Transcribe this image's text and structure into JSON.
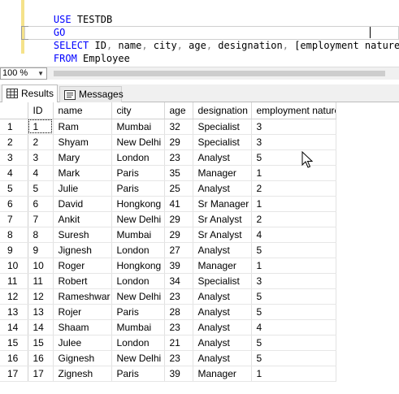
{
  "editor": {
    "line1": {
      "kw": "USE",
      "rest": " TESTDB"
    },
    "line2": {
      "kw": "GO"
    },
    "line3": {
      "kw": "SELECT",
      "p1": " ID",
      "c1": ",",
      "p2": " name",
      "c2": ",",
      "p3": " city",
      "c3": ",",
      "p4": " age",
      "c4": ",",
      "p5": " designation",
      "c5": ",",
      "p6": " [employment nature]"
    },
    "line4": {
      "kw": "FROM",
      "rest": " Employee"
    }
  },
  "zoom": {
    "value": "100 %",
    "arrow": "▼"
  },
  "tabs": [
    {
      "label": "Results",
      "icon": "grid-results-icon"
    },
    {
      "label": "Messages",
      "icon": "messages-icon"
    }
  ],
  "grid": {
    "columns": [
      "ID",
      "name",
      "city",
      "age",
      "designation",
      "employment nature"
    ],
    "rows": [
      {
        "n": "1",
        "id": "1",
        "name": "Ram",
        "city": "Mumbai",
        "age": "32",
        "designation": "Specialist",
        "nature": "3"
      },
      {
        "n": "2",
        "id": "2",
        "name": "Shyam",
        "city": "New Delhi",
        "age": "29",
        "designation": "Specialist",
        "nature": "3"
      },
      {
        "n": "3",
        "id": "3",
        "name": "Mary",
        "city": "London",
        "age": "23",
        "designation": "Analyst",
        "nature": "5"
      },
      {
        "n": "4",
        "id": "4",
        "name": "Mark",
        "city": "Paris",
        "age": "35",
        "designation": "Manager",
        "nature": "1"
      },
      {
        "n": "5",
        "id": "5",
        "name": "Julie",
        "city": "Paris",
        "age": "25",
        "designation": "Analyst",
        "nature": "2"
      },
      {
        "n": "6",
        "id": "6",
        "name": "David",
        "city": "Hongkong",
        "age": "41",
        "designation": "Sr Manager",
        "nature": "1"
      },
      {
        "n": "7",
        "id": "7",
        "name": "Ankit",
        "city": "New Delhi",
        "age": "29",
        "designation": "Sr Analyst",
        "nature": "2"
      },
      {
        "n": "8",
        "id": "8",
        "name": "Suresh",
        "city": "Mumbai",
        "age": "29",
        "designation": "Sr Analyst",
        "nature": "4"
      },
      {
        "n": "9",
        "id": "9",
        "name": "Jignesh",
        "city": "London",
        "age": "27",
        "designation": "Analyst",
        "nature": "5"
      },
      {
        "n": "10",
        "id": "10",
        "name": "Roger",
        "city": "Hongkong",
        "age": "39",
        "designation": "Manager",
        "nature": "1"
      },
      {
        "n": "11",
        "id": "11",
        "name": "Robert",
        "city": "London",
        "age": "34",
        "designation": "Specialist",
        "nature": "3"
      },
      {
        "n": "12",
        "id": "12",
        "name": "Rameshwar",
        "city": "New Delhi",
        "age": "23",
        "designation": "Analyst",
        "nature": "5"
      },
      {
        "n": "13",
        "id": "13",
        "name": "Rojer",
        "city": "Paris",
        "age": "28",
        "designation": "Analyst",
        "nature": "5"
      },
      {
        "n": "14",
        "id": "14",
        "name": "Shaam",
        "city": "Mumbai",
        "age": "23",
        "designation": "Analyst",
        "nature": "4"
      },
      {
        "n": "15",
        "id": "15",
        "name": "Julee",
        "city": "London",
        "age": "21",
        "designation": "Analyst",
        "nature": "5"
      },
      {
        "n": "16",
        "id": "16",
        "name": "Gignesh",
        "city": "New Delhi",
        "age": "23",
        "designation": "Analyst",
        "nature": "5"
      },
      {
        "n": "17",
        "id": "17",
        "name": "Zignesh",
        "city": "Paris",
        "age": "39",
        "designation": "Manager",
        "nature": "1"
      }
    ]
  },
  "colors": {
    "keyword": "#0000ff",
    "operator": "#808080",
    "function_like": "#ff00ff",
    "gutter": "#f5e28a"
  }
}
